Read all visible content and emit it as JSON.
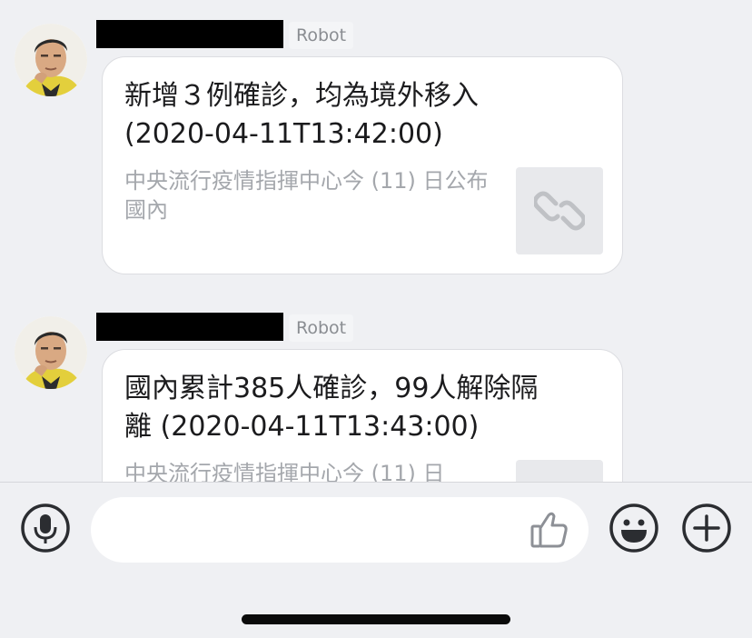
{
  "messages": [
    {
      "sender_tag": "Robot",
      "title": "新增３例確診，均為境外移入 (2020-04-11T13:42:00)",
      "description": "中央流行疫情指揮中心今 (11) 日公布國內",
      "thumbnail_icon": "link-icon"
    },
    {
      "sender_tag": "Robot",
      "title": "國內累計385人確診，99人解除隔離 (2020-04-11T13:43:00)",
      "description": "中央流行疫情指揮中心今 (11) 日",
      "thumbnail_icon": "link-icon"
    }
  ],
  "input_bar": {
    "mic_icon": "microphone-icon",
    "input_value": "",
    "like_icon": "thumbs-up-icon",
    "emoji_icon": "smiley-icon",
    "plus_icon": "plus-circle-icon"
  },
  "colors": {
    "background": "#eff0f3",
    "card": "#ffffff",
    "title_text": "#1b1b1d",
    "desc_text": "#a4a7ac",
    "icon": "#2b2d31"
  }
}
